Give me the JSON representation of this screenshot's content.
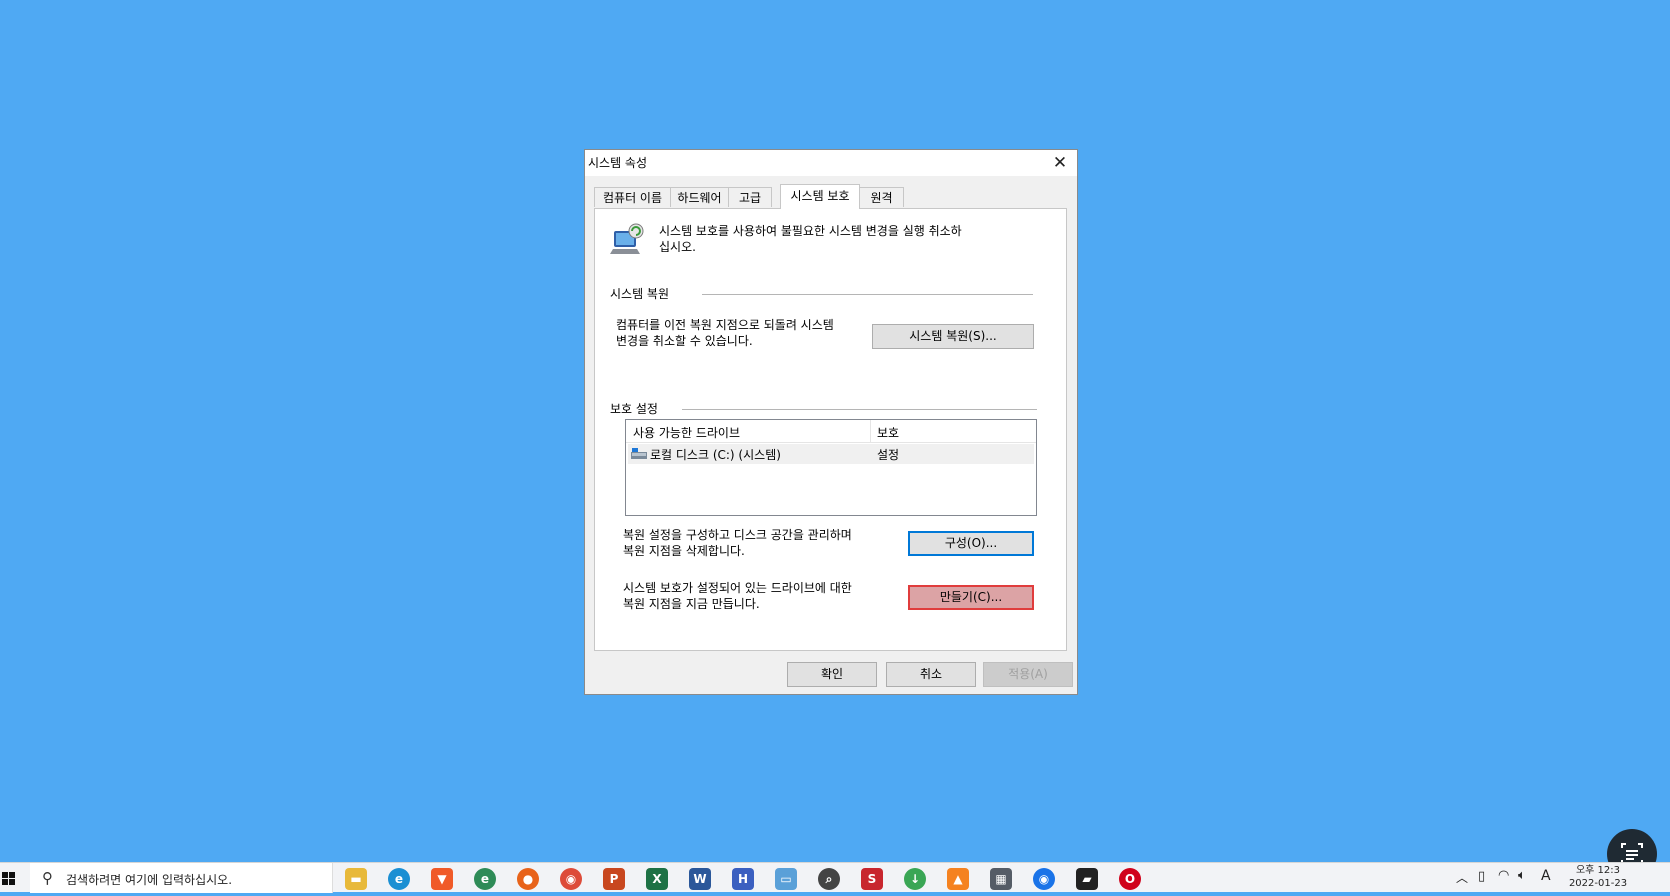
{
  "dialog": {
    "title": "시스템 속성",
    "tabs": [
      {
        "label": "컴퓨터 이름"
      },
      {
        "label": "하드웨어"
      },
      {
        "label": "고급"
      },
      {
        "label": "시스템 보호"
      },
      {
        "label": "원격"
      }
    ],
    "description_line1": "시스템 보호를 사용하여 불필요한 시스템 변경을 실행 취소하",
    "description_line2": "십시오.",
    "restore": {
      "group_label": "시스템 복원",
      "text_line1": "컴퓨터를 이전 복원 지점으로 되돌려 시스템",
      "text_line2": "변경을 취소할 수 있습니다.",
      "button": "시스템 복원(S)..."
    },
    "protection": {
      "group_label": "보호 설정",
      "columns": [
        "사용 가능한 드라이브",
        "보호"
      ],
      "rows": [
        {
          "drive": "로컬 디스크 (C:) (시스템)",
          "protection": "설정"
        }
      ],
      "configure_line1": "복원 설정을 구성하고 디스크 공간을 관리하며",
      "configure_line2": "복원 지점을 삭제합니다.",
      "configure_button": "구성(O)...",
      "create_line1": "시스템 보호가 설정되어 있는 드라이브에 대한",
      "create_line2": "복원 지점을 지금 만듭니다.",
      "create_button": "만들기(C)..."
    },
    "footer": {
      "ok": "확인",
      "cancel": "취소",
      "apply": "적용(A)"
    }
  },
  "taskbar": {
    "search_placeholder": "검색하려면 여기에 입력하십시오.",
    "tray_ime": "A",
    "clock_time": "오후 12:3",
    "clock_date": "2022-01-23"
  },
  "colors": {
    "desktop": "#4fa9f3",
    "create_highlight": "#dca3a5",
    "focus_blue": "#0078d7"
  }
}
